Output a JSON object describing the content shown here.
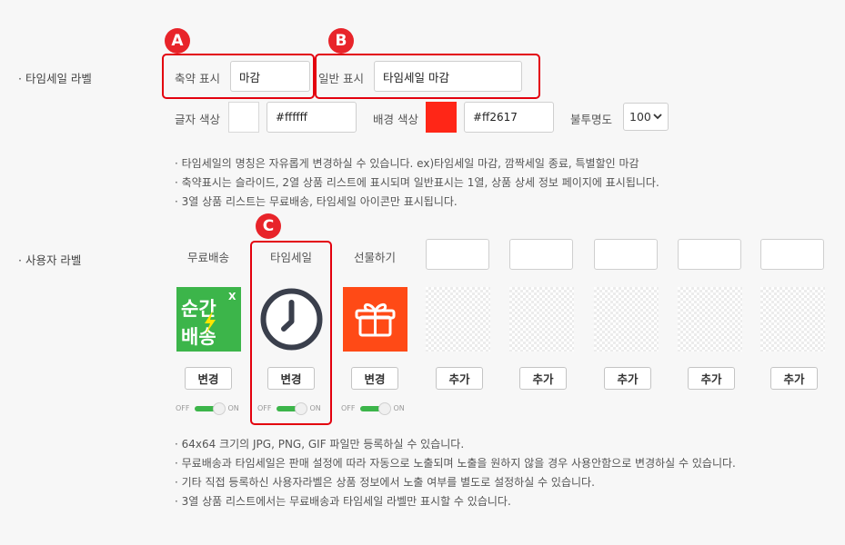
{
  "timesale_label": {
    "section_title": "· 타임세일 라벨",
    "short_label": "축약 표시",
    "short_value": "마감",
    "normal_label": "일반 표시",
    "normal_value": "타임세일 마감",
    "text_color_label": "글자 색상",
    "text_color_value": "#ffffff",
    "bg_color_label": "배경 색상",
    "bg_color_value": "#ff2617",
    "opacity_label": "불투명도",
    "opacity_value": "100",
    "notes": [
      "· 타임세일의 명칭은 자유롭게 변경하실 수 있습니다. ex)타임세일 마감, 깜짝세일 종료, 특별할인 마감",
      "· 축약표시는 슬라이드, 2열 상품 리스트에 표시되며 일반표시는 1열, 상품 상세 정보 페이지에 표시됩니다.",
      "· 3열 상품 리스트는 무료배송, 타임세일 아이콘만 표시됩니다."
    ]
  },
  "user_label": {
    "section_title": "· 사용자 라벨",
    "columns": [
      {
        "title": "무료배송",
        "button": "변경",
        "toggle_off": "OFF",
        "toggle_on": "ON",
        "icon": "free-delivery-icon",
        "icon_text_1": "순간",
        "icon_text_2": "배송",
        "icon_text_x": "X"
      },
      {
        "title": "타임세일",
        "button": "변경",
        "toggle_off": "OFF",
        "toggle_on": "ON",
        "icon": "clock-icon"
      },
      {
        "title": "선물하기",
        "button": "변경",
        "toggle_off": "OFF",
        "toggle_on": "ON",
        "icon": "gift-icon"
      },
      {
        "title": "",
        "button": "추가"
      },
      {
        "title": "",
        "button": "추가"
      },
      {
        "title": "",
        "button": "추가"
      },
      {
        "title": "",
        "button": "추가"
      },
      {
        "title": "",
        "button": "추가"
      }
    ],
    "notes": [
      "· 64x64 크기의 JPG, PNG, GIF 파일만 등록하실 수 있습니다.",
      "· 무료배송과 타임세일은 판매 설정에 따라 자동으로 노출되며 노출을 원하지 않을 경우 사용안함으로 변경하실 수 있습니다.",
      "· 기타 직접 등록하신 사용자라벨은 상품 정보에서 노출 여부를 별도로 설정하실 수 있습니다.",
      "· 3열 상품 리스트에서는 무료배송과 타임세일 라벨만 표시할 수 있습니다."
    ]
  },
  "annotations": {
    "a": "A",
    "b": "B",
    "c": "C"
  },
  "colors": {
    "accent_red": "#e3000e",
    "toggle_green": "#3cb54a",
    "delivery_green": "#3cb54a",
    "gift_orange": "#ff4a16"
  }
}
